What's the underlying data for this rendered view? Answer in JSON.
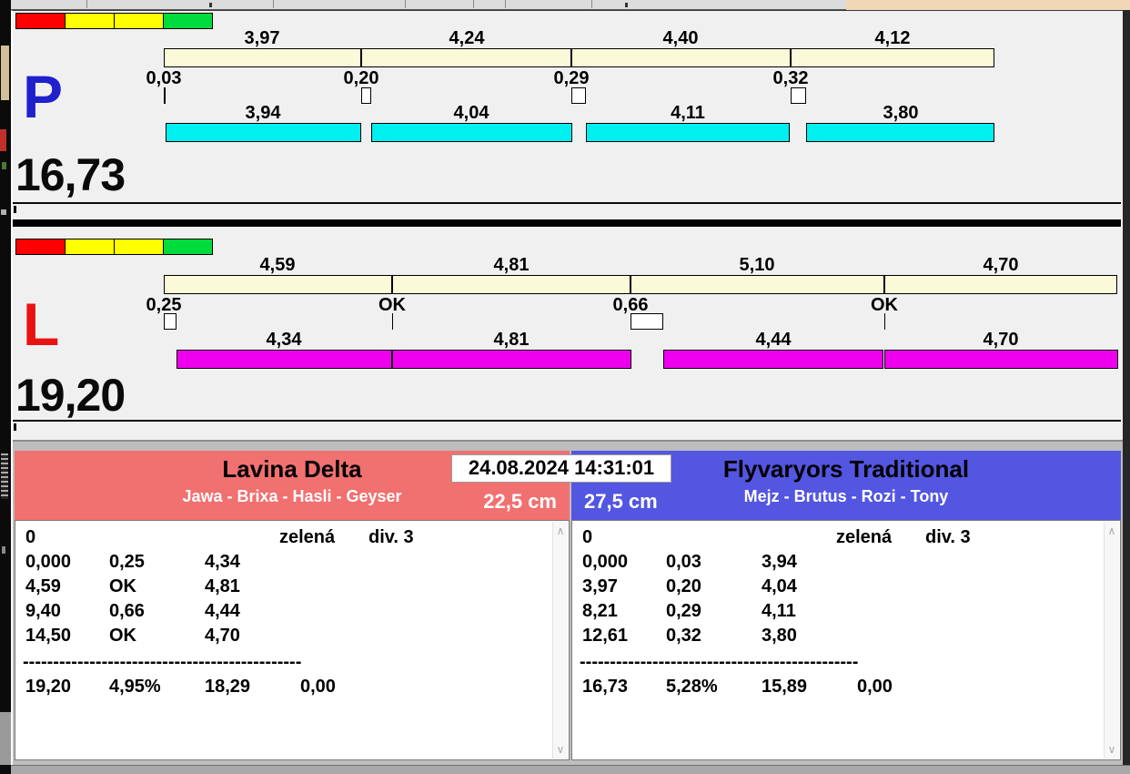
{
  "colors": {
    "window_background": "#f0f0f0",
    "split_bar": "#fafad8",
    "lane_p_dog_bar": "#00efef",
    "lane_l_dog_bar": "#ee00ee",
    "lamp_red": "#ff0000",
    "lamp_yellow": "#ffff00",
    "lamp_green": "#00dc3c",
    "left_team_header": "#f17070",
    "right_team_header": "#5356e0"
  },
  "icons": {
    "scroll_up": "∧",
    "scroll_down": "∨"
  },
  "lanes": [
    {
      "letter": "P",
      "letter_color": "#2020cc",
      "dog_bar_color": "#00efef",
      "total_label": "16,73",
      "total_seconds": 16.73,
      "legend_colors": [
        "#ff0000",
        "#ffff00",
        "#ffff00",
        "#00dc3c"
      ],
      "laps": [
        {
          "split_label": "3,97",
          "split_s": 3.97,
          "pass_label": "0,03",
          "pass_s": 0.03,
          "dog_label": "3,94",
          "dog_s": 3.94
        },
        {
          "split_label": "4,24",
          "split_s": 4.24,
          "pass_label": "0,20",
          "pass_s": 0.2,
          "dog_label": "4,04",
          "dog_s": 4.04
        },
        {
          "split_label": "4,40",
          "split_s": 4.4,
          "pass_label": "0,29",
          "pass_s": 0.29,
          "dog_label": "4,11",
          "dog_s": 4.11
        },
        {
          "split_label": "4,12",
          "split_s": 4.12,
          "pass_label": "0,32",
          "pass_s": 0.32,
          "dog_label": "3,80",
          "dog_s": 3.8
        }
      ]
    },
    {
      "letter": "L",
      "letter_color": "#e81212",
      "dog_bar_color": "#ee00ee",
      "total_label": "19,20",
      "total_seconds": 19.2,
      "legend_colors": [
        "#ff0000",
        "#ffff00",
        "#ffff00",
        "#00dc3c"
      ],
      "laps": [
        {
          "split_label": "4,59",
          "split_s": 4.59,
          "pass_label": "0,25",
          "pass_s": 0.25,
          "dog_label": "4,34",
          "dog_s": 4.34
        },
        {
          "split_label": "4,81",
          "split_s": 4.81,
          "pass_label": "OK",
          "pass_s": null,
          "dog_label": "4,81",
          "dog_s": 4.81
        },
        {
          "split_label": "5,10",
          "split_s": 5.1,
          "pass_label": "0,66",
          "pass_s": 0.66,
          "dog_label": "4,44",
          "dog_s": 4.44
        },
        {
          "split_label": "4,70",
          "split_s": 4.7,
          "pass_label": "OK",
          "pass_s": null,
          "dog_label": "4,70",
          "dog_s": 4.7
        }
      ]
    }
  ],
  "scoreboard": {
    "datetime": "24.08.2024 14:31:01",
    "left_panel": {
      "team": "Lavina Delta",
      "dogs": "Jawa - Brixa - Hasli - Geyser",
      "jump_height": "22,5 cm",
      "header_color": "#f17070",
      "info_row": [
        "0",
        "zelená",
        "div. 3"
      ],
      "rows": [
        [
          "0,000",
          "0,25",
          "4,34"
        ],
        [
          "4,59",
          "OK",
          "4,81"
        ],
        [
          "9,40",
          "0,66",
          "4,44"
        ],
        [
          "14,50",
          "OK",
          "4,70"
        ]
      ],
      "separator": "----------------------------------------------",
      "total_row": [
        "19,20",
        "4,95%",
        "18,29",
        "0,00"
      ]
    },
    "right_panel": {
      "team": "Flyvaryors Traditional",
      "dogs": "Mejz - Brutus - Rozi - Tony",
      "jump_height": "27,5 cm",
      "header_color": "#5356e0",
      "info_row": [
        "0",
        "zelená",
        "div. 3"
      ],
      "rows": [
        [
          "0,000",
          "0,03",
          "3,94"
        ],
        [
          "3,97",
          "0,20",
          "4,04"
        ],
        [
          "8,21",
          "0,29",
          "4,11"
        ],
        [
          "12,61",
          "0,32",
          "3,80"
        ]
      ],
      "separator": "----------------------------------------------",
      "total_row": [
        "16,73",
        "5,28%",
        "15,89",
        "0,00"
      ]
    }
  }
}
